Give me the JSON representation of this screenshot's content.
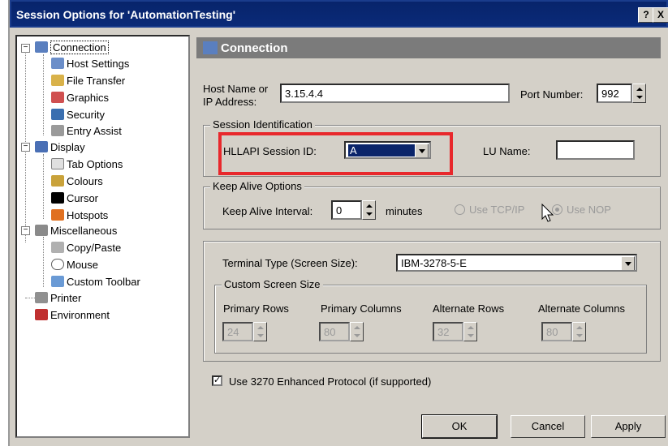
{
  "window": {
    "title": "Session Options for 'AutomationTesting'",
    "help_label": "?",
    "close_label": "X"
  },
  "tree": {
    "items": [
      {
        "label": "Connection",
        "icon": "connection-icon"
      },
      {
        "label": "Host Settings",
        "icon": "host-settings-icon"
      },
      {
        "label": "File Transfer",
        "icon": "file-transfer-icon"
      },
      {
        "label": "Graphics",
        "icon": "graphics-icon"
      },
      {
        "label": "Security",
        "icon": "security-icon"
      },
      {
        "label": "Entry Assist",
        "icon": "entry-assist-icon"
      },
      {
        "label": "Display",
        "icon": "display-icon"
      },
      {
        "label": "Tab Options",
        "icon": "tab-options-icon"
      },
      {
        "label": "Colours",
        "icon": "colours-icon"
      },
      {
        "label": "Cursor",
        "icon": "cursor-icon"
      },
      {
        "label": "Hotspots",
        "icon": "hotspots-icon"
      },
      {
        "label": "Miscellaneous",
        "icon": "miscellaneous-icon"
      },
      {
        "label": "Copy/Paste",
        "icon": "copy-paste-icon"
      },
      {
        "label": "Mouse",
        "icon": "mouse-icon"
      },
      {
        "label": "Custom Toolbar",
        "icon": "custom-toolbar-icon"
      },
      {
        "label": "Printer",
        "icon": "printer-icon"
      },
      {
        "label": "Environment",
        "icon": "environment-icon"
      }
    ]
  },
  "panel": {
    "header": "Connection",
    "host_label_1": "Host Name or",
    "host_label_2": "IP Address:",
    "host_value": "3.15.4.4",
    "port_label": "Port Number:",
    "port_value": "992",
    "session_group": "Session Identification",
    "hllapi_label": "HLLAPI Session ID:",
    "hllapi_value": "A",
    "lu_label": "LU Name:",
    "lu_value": "",
    "keepalive_group": "Keep Alive Options",
    "keepalive_label": "Keep Alive Interval:",
    "keepalive_value": "0",
    "minutes_label": "minutes",
    "tcpip_label": "Use TCP/IP",
    "nop_label": "Use NOP",
    "terminal_label": "Terminal Type (Screen Size):",
    "terminal_value": "IBM-3278-5-E",
    "custom_group": "Custom Screen Size",
    "primary_rows_label": "Primary Rows",
    "primary_rows_value": "24",
    "primary_cols_label": "Primary Columns",
    "primary_cols_value": "80",
    "alt_rows_label": "Alternate Rows",
    "alt_rows_value": "32",
    "alt_cols_label": "Alternate Columns",
    "alt_cols_value": "80",
    "protocol_label": "Use 3270 Enhanced Protocol (if supported)",
    "protocol_checked": true
  },
  "buttons": {
    "ok": "OK",
    "cancel": "Cancel",
    "apply": "Apply"
  },
  "colors": {
    "titlebar": "#0a2a78",
    "highlight": "#e8282c",
    "selection": "#0a246a",
    "panel_header": "#7b7b7b"
  }
}
